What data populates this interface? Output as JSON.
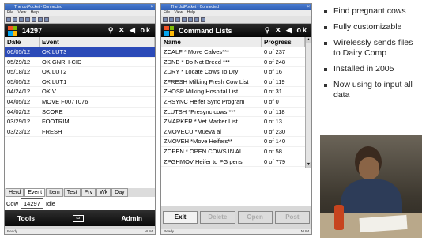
{
  "left_screen": {
    "os_title": "The dotPocket - Connected",
    "menu": [
      "File",
      "View",
      "Help"
    ],
    "header_title": "14297",
    "header_ok": "ok",
    "columns": [
      "Date",
      "Event"
    ],
    "rows": [
      {
        "date": "06/05/12",
        "event": "OK LUT3",
        "selected": true
      },
      {
        "date": "05/29/12",
        "event": "OK GNRH-CID",
        "selected": false
      },
      {
        "date": "05/18/12",
        "event": "OK LUT2",
        "selected": false
      },
      {
        "date": "05/05/12",
        "event": "OK LUT1",
        "selected": false
      },
      {
        "date": "04/24/12",
        "event": "OK V",
        "selected": false
      },
      {
        "date": "04/05/12",
        "event": "MOVE F007T076",
        "selected": false
      },
      {
        "date": "04/02/12",
        "event": "SCORE",
        "selected": false
      },
      {
        "date": "03/29/12",
        "event": "FOOTRIM",
        "selected": false
      },
      {
        "date": "03/23/12",
        "event": "FRESH",
        "selected": false
      }
    ],
    "tabs": [
      "Herd",
      "Event",
      "Item",
      "Test",
      "Prv",
      "Wk",
      "Day"
    ],
    "cow_label": "Cow",
    "cow_value": "14297",
    "cow_status": "Idle",
    "softkey_left": "Tools",
    "softkey_right": "Admin",
    "status_left": "Ready",
    "status_right": "NUM"
  },
  "right_screen": {
    "os_title": "The dotPocket - Connected",
    "menu": [
      "File",
      "View",
      "Help"
    ],
    "header_title": "Command Lists",
    "header_ok": "ok",
    "columns": [
      "Name",
      "Progress"
    ],
    "rows": [
      {
        "name": "ZCALF  * Move Calves***",
        "progress": "0 of 237",
        "selected": false
      },
      {
        "name": "ZDNB  * Do Not Breed ***",
        "progress": "0 of 248",
        "selected": false
      },
      {
        "name": "ZDRY  * Locate Cows To Dry",
        "progress": "0 of 16",
        "selected": false
      },
      {
        "name": "ZFRESH  Milking Fresh Cow List",
        "progress": "0 of 119",
        "selected": false
      },
      {
        "name": "ZHOSP  Milking Hospital List",
        "progress": "0 of 31",
        "selected": false
      },
      {
        "name": "ZHSYNC  Heifer Sync Program",
        "progress": "0 of 0",
        "selected": false
      },
      {
        "name": "ZLUTSH  *Presync cows  ***",
        "progress": "0 of 118",
        "selected": false
      },
      {
        "name": "ZMARKER  * Vet Marker List",
        "progress": "0 of 13",
        "selected": false
      },
      {
        "name": "ZMOVECU  *Mueva al",
        "progress": "0 of 230",
        "selected": false
      },
      {
        "name": "ZMOVEH  *Move Heifers**",
        "progress": "0 of 140",
        "selected": false
      },
      {
        "name": "ZOPEN  * OPEN COWS IN AI",
        "progress": "0 of 58",
        "selected": false
      },
      {
        "name": "ZPGHMOV  Heifer to PG pens",
        "progress": "0 of 779",
        "selected": false
      }
    ],
    "buttons": [
      {
        "label": "Exit",
        "enabled": true
      },
      {
        "label": "Delete",
        "enabled": false
      },
      {
        "label": "Open",
        "enabled": false
      },
      {
        "label": "Post",
        "enabled": false
      }
    ],
    "status_left": "Ready",
    "status_right": "NUM"
  },
  "bullets": [
    "Find pregnant cows",
    "Fully customizable",
    "Wirelessly sends files to Dairy Comp",
    "Installed in 2005",
    "Now using to input all data"
  ],
  "colors": {
    "selection": "#2b4ab8",
    "title_bar": "#2f5fb5",
    "softkey_bar": "#090909"
  },
  "icons": [
    "windows-logo-icon",
    "signal-icon",
    "no-signal-icon",
    "speaker-icon",
    "keyboard-icon"
  ]
}
